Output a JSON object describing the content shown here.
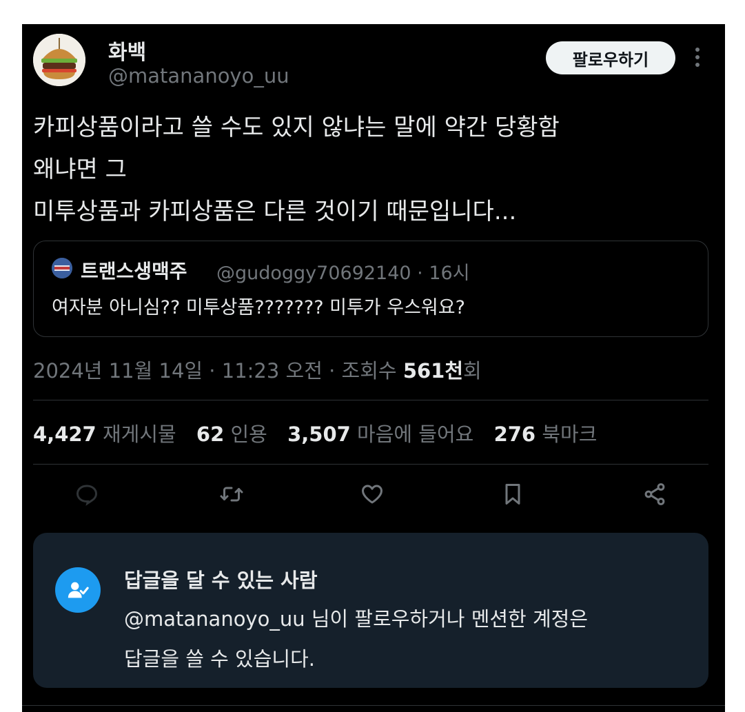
{
  "author": {
    "display_name": "화백",
    "handle": "@matananoyo_uu"
  },
  "follow_button_label": "팔로우하기",
  "tweet_lines": [
    "카피상품이라고 쓸 수도 있지 않냐는 말에 약간 당황함",
    "왜냐면 그",
    "미투상품과 카피상품은 다른 것이기 때문입니다..."
  ],
  "quoted": {
    "display_name": "트랜스생맥주",
    "meta": "@gudoggy70692140 · 16시",
    "text": "여자분 아니심?? 미투상품??????? 미투가 우스워요?"
  },
  "meta": {
    "datetime": "2024년 11월 14일 · 11:23 오전 · 조회수 ",
    "views_value": "561천",
    "views_suffix": "회"
  },
  "stats": [
    {
      "value": "4,427",
      "label": "재게시물"
    },
    {
      "value": "62",
      "label": "인용"
    },
    {
      "value": "3,507",
      "label": "마음에 들어요"
    },
    {
      "value": "276",
      "label": "북마크"
    }
  ],
  "reply_restriction": {
    "title": "답글을 달 수 있는 사람",
    "body_lines": [
      "@matananoyo_uu 님이 팔로우하거나 멘션한 계정은",
      "답글을 쓸 수 있습니다."
    ]
  },
  "colors": {
    "background": "#000000",
    "text_primary": "#e7e9ea",
    "text_secondary": "#71767b",
    "accent": "#1d9bf0",
    "info_box": "#15202b"
  },
  "icons": [
    "more-icon",
    "reply-icon",
    "retweet-icon",
    "like-icon",
    "bookmark-icon",
    "share-icon",
    "user-check-icon"
  ]
}
